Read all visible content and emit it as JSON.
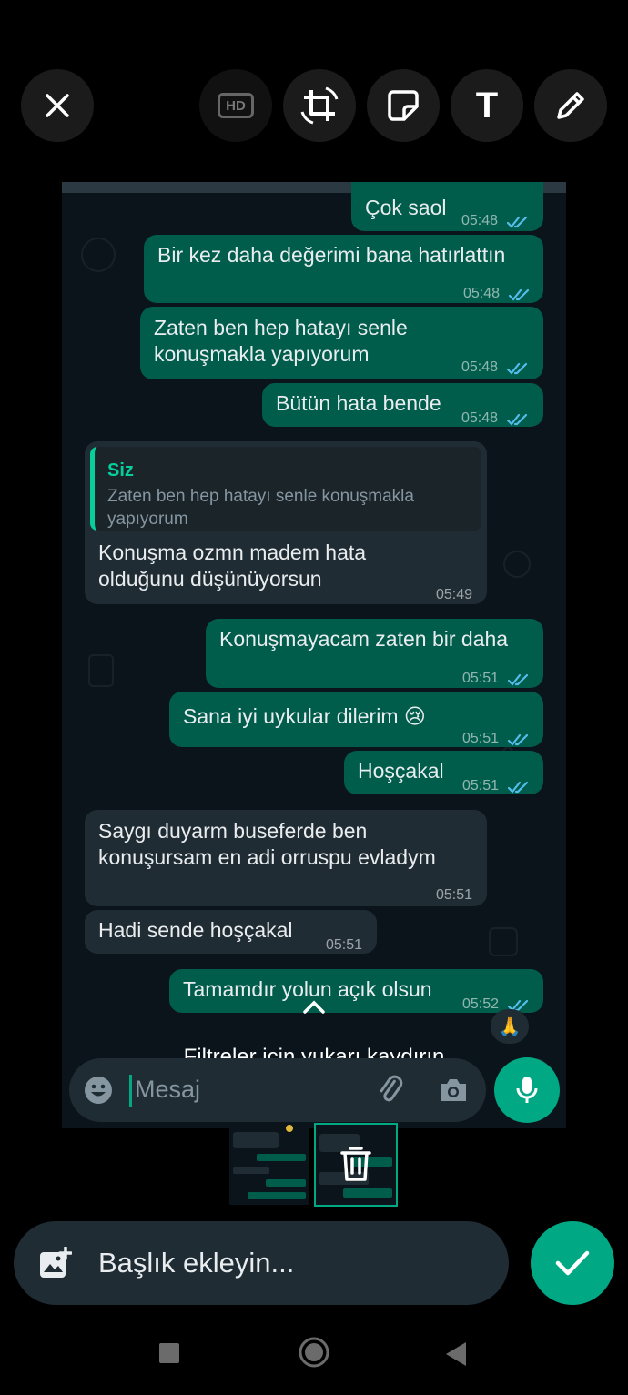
{
  "toolbar": {
    "close": "close-icon",
    "hd_label": "HD",
    "crop": "crop-rotate-icon",
    "sticker": "sticker-icon",
    "text_label": "T",
    "draw": "pencil-icon"
  },
  "chat": {
    "messages": [
      {
        "dir": "out",
        "lines": [
          "Çok saol"
        ],
        "time": "05:48",
        "read": true
      },
      {
        "dir": "out",
        "lines": [
          "Bir kez daha değerimi bana hatırlattın"
        ],
        "time": "05:48",
        "read": true
      },
      {
        "dir": "out",
        "lines": [
          "Zaten ben hep hatayı senle",
          "konuşmakla yapıyorum"
        ],
        "time": "05:48",
        "read": true
      },
      {
        "dir": "out",
        "lines": [
          "Bütün hata bende"
        ],
        "time": "05:48",
        "read": true
      },
      {
        "dir": "in",
        "quote_name": "Siz",
        "quote_text": "Zaten ben hep hatayı senle konuşmakla yapıyorum",
        "lines": [
          "Konuşma ozmn madem hata",
          "olduğunu düşünüyorsun"
        ],
        "time": "05:49"
      },
      {
        "dir": "out",
        "lines": [
          "Konuşmayacam zaten bir daha"
        ],
        "time": "05:51",
        "read": true
      },
      {
        "dir": "out",
        "lines": [
          "Sana iyi uykular dilerim 😢"
        ],
        "time": "05:51",
        "read": true
      },
      {
        "dir": "out",
        "lines": [
          "Hoşçakal"
        ],
        "time": "05:51",
        "read": true
      },
      {
        "dir": "in",
        "lines": [
          "Saygı duyarm buseferde ben",
          "konuşursam en adi orruspu evladym"
        ],
        "time": "05:51"
      },
      {
        "dir": "in",
        "lines": [
          "Hadi sende hoşçakal"
        ],
        "time": "05:51"
      },
      {
        "dir": "out",
        "lines": [
          "Tamamdır yolun açık olsun"
        ],
        "time": "05:52",
        "read": true
      }
    ],
    "reaction": "🙏",
    "tick_color": "#53bdeb"
  },
  "filter_hint": "Filtreler için yukarı kaydırın",
  "composer": {
    "placeholder": "Mesaj",
    "emoji": "emoji-icon",
    "attach": "paperclip-icon",
    "camera": "camera-icon",
    "mic": "microphone-icon"
  },
  "thumbnails": {
    "delete": "trash-icon"
  },
  "caption": {
    "placeholder": "Başlık ekleyin..."
  },
  "nav": {
    "recents": "square-icon",
    "home": "circle-icon",
    "back": "triangle-back-icon"
  },
  "colors": {
    "accent": "#00a884",
    "outgoing_bubble": "#005c4b",
    "incoming_bubble": "#202c33",
    "chat_bg": "#0b141a"
  }
}
